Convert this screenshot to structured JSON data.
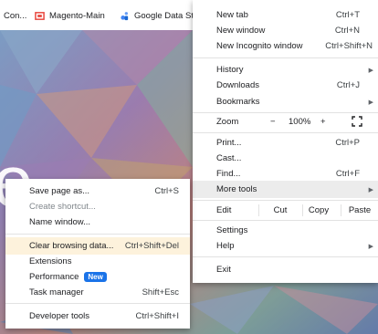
{
  "bookmarks": [
    {
      "label": "Con...",
      "icon": "page-icon"
    },
    {
      "label": "Magento-Main",
      "icon": "magento-icon",
      "color": "#e8453c"
    },
    {
      "label": "Google Data Stu",
      "icon": "data-studio-icon",
      "color": "#4285f4"
    }
  ],
  "main_menu": {
    "new_tab": {
      "label": "New tab",
      "shortcut": "Ctrl+T"
    },
    "new_window": {
      "label": "New window",
      "shortcut": "Ctrl+N"
    },
    "new_incognito": {
      "label": "New Incognito window",
      "shortcut": "Ctrl+Shift+N"
    },
    "history": {
      "label": "History"
    },
    "downloads": {
      "label": "Downloads",
      "shortcut": "Ctrl+J"
    },
    "bookmarks": {
      "label": "Bookmarks"
    },
    "zoom": {
      "label": "Zoom",
      "minus": "−",
      "value": "100%",
      "plus": "+"
    },
    "print": {
      "label": "Print...",
      "shortcut": "Ctrl+P"
    },
    "cast": {
      "label": "Cast..."
    },
    "find": {
      "label": "Find...",
      "shortcut": "Ctrl+F"
    },
    "more_tools": {
      "label": "More tools"
    },
    "edit": {
      "label": "Edit",
      "cut": "Cut",
      "copy": "Copy",
      "paste": "Paste"
    },
    "settings": {
      "label": "Settings"
    },
    "help": {
      "label": "Help"
    },
    "exit": {
      "label": "Exit"
    }
  },
  "more_tools_menu": {
    "save_page": {
      "label": "Save page as...",
      "shortcut": "Ctrl+S"
    },
    "create_shortcut": {
      "label": "Create shortcut..."
    },
    "name_window": {
      "label": "Name window..."
    },
    "clear_browsing": {
      "label": "Clear browsing data...",
      "shortcut": "Ctrl+Shift+Del"
    },
    "extensions": {
      "label": "Extensions"
    },
    "performance": {
      "label": "Performance",
      "badge": "New"
    },
    "task_manager": {
      "label": "Task manager",
      "shortcut": "Shift+Esc"
    },
    "developer_tools": {
      "label": "Developer tools",
      "shortcut": "Ctrl+Shift+I"
    }
  },
  "wallpaper_glyph": "e",
  "colors": {
    "accent": "#1a73e8",
    "highlight": "#ececec",
    "highlight_yellow": "#fdf2dc"
  }
}
